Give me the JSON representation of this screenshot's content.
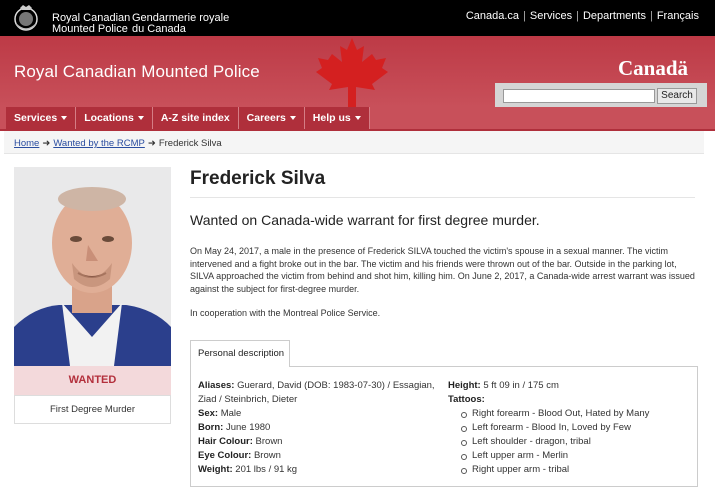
{
  "header": {
    "org_name_en": [
      "Royal Canadian",
      "Mounted Police"
    ],
    "org_name_fr": [
      "Gendarmerie royale",
      "du Canada"
    ],
    "top_links": [
      "Canada.ca",
      "Services",
      "Departments",
      "Français"
    ]
  },
  "banner": {
    "title": "Royal Canadian Mounted Police",
    "wordmark": "Canadä",
    "search_button": "Search",
    "search_value": ""
  },
  "nav": {
    "items": [
      {
        "label": "Services",
        "has_menu": true
      },
      {
        "label": "Locations",
        "has_menu": true
      },
      {
        "label": "A-Z site index",
        "has_menu": false
      },
      {
        "label": "Careers",
        "has_menu": true
      },
      {
        "label": "Help us",
        "has_menu": true
      }
    ]
  },
  "breadcrumb": {
    "items": [
      "Home",
      "Wanted by the RCMP",
      "Frederick Silva"
    ]
  },
  "profile": {
    "status": "WANTED",
    "charge": "First Degree Murder",
    "name": "Frederick Silva",
    "subtitle": "Wanted on Canada-wide warrant for first degree murder.",
    "description": "On May 24, 2017, a male in the presence of Frederick SILVA touched the victim's spouse in a sexual manner. The victim intervened and a fight broke out in the bar. The victim and his friends were thrown out of the bar. Outside in the parking lot, SILVA approached the victim from behind and shot him, killing him. On June 2, 2017, a Canada-wide arrest warrant was issued against the subject for first-degree murder.",
    "cooperation": "In cooperation with the Montreal Police Service."
  },
  "details": {
    "tab_label": "Personal description",
    "aliases_label": "Aliases:",
    "aliases_value_1": "Guerard, David (DOB: 1983-07-30) / Essagian,",
    "aliases_value_2": "Ziad / Steinbrich, Dieter",
    "sex_label": "Sex:",
    "sex_value": "Male",
    "born_label": "Born:",
    "born_value": "June 1980",
    "hair_label": "Hair Colour:",
    "hair_value": "Brown",
    "eye_label": "Eye Colour:",
    "eye_value": "Brown",
    "weight_label": "Weight:",
    "weight_value": "201 lbs / 91 kg",
    "height_label": "Height:",
    "height_value": "5 ft 09 in / 175 cm",
    "tattoos_label": "Tattoos:",
    "tattoos": [
      "Right forearm - Blood Out, Hated by Many",
      "Left forearm - Blood In, Loved by Few",
      "Left shoulder - dragon, tribal",
      "Left upper arm - Merlin",
      "Right upper arm - tribal"
    ]
  },
  "colors": {
    "topbar": "#000000",
    "banner": "#c8505a",
    "nav_item": "#af2f3b",
    "wanted_bg": "#f3d9db",
    "wanted_text": "#b3303c",
    "link": "#2a4da0"
  }
}
